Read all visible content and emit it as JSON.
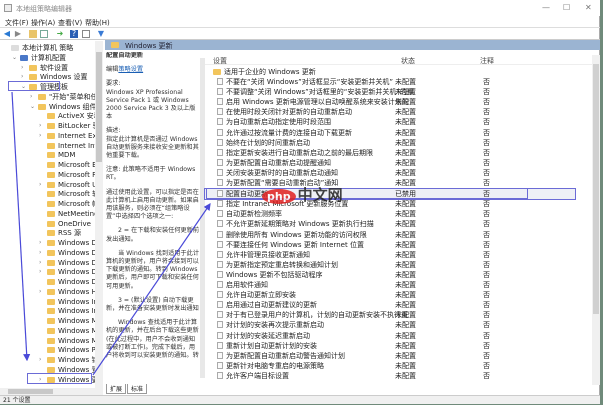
{
  "window": {
    "title": "本地组策略编辑器",
    "controls": [
      "—",
      "☐",
      "✕"
    ]
  },
  "menu": [
    "文件(F)",
    "操作(A)",
    "查看(V)",
    "帮助(H)"
  ],
  "tree": [
    {
      "label": "本地计算机 策略",
      "level": 0,
      "chev": ""
    },
    {
      "label": "计算机配置",
      "level": 1,
      "chev": "v"
    },
    {
      "label": "软件设置",
      "level": 2,
      "chev": ">"
    },
    {
      "label": "Windows 设置",
      "level": 2,
      "chev": ">"
    },
    {
      "label": "管理模板",
      "level": 2,
      "chev": "v"
    },
    {
      "label": "\"开始\"菜单和任务栏",
      "level": 3,
      "chev": ">"
    },
    {
      "label": "Windows 组件",
      "level": 3,
      "chev": "v"
    },
    {
      "label": "ActiveX 安装程序",
      "level": 4,
      "chev": ""
    },
    {
      "label": "BitLocker 驱动器",
      "level": 4,
      "chev": ">"
    },
    {
      "label": "Internet Explorer",
      "level": 4,
      "chev": ">"
    },
    {
      "label": "Internet Informa",
      "level": 4,
      "chev": ""
    },
    {
      "label": "MDM",
      "level": 4,
      "chev": ""
    },
    {
      "label": "Microsoft Edge",
      "level": 4,
      "chev": ""
    },
    {
      "label": "Microsoft FIDO",
      "level": 4,
      "chev": ""
    },
    {
      "label": "Microsoft User E",
      "level": 4,
      "chev": ">"
    },
    {
      "label": "Microsoft 辅助",
      "level": 4,
      "chev": ""
    },
    {
      "label": "Microsoft 帐户",
      "level": 4,
      "chev": ""
    },
    {
      "label": "NetMeeting",
      "level": 4,
      "chev": ""
    },
    {
      "label": "OneDrive",
      "level": 4,
      "chev": ""
    },
    {
      "label": "RSS 源",
      "level": 4,
      "chev": ""
    },
    {
      "label": "Windows Defen",
      "level": 4,
      "chev": ">"
    },
    {
      "label": "Windows Defen",
      "level": 4,
      "chev": ">"
    },
    {
      "label": "Windows Defen",
      "level": 4,
      "chev": ">"
    },
    {
      "label": "Windows Defen",
      "level": 4,
      "chev": ">"
    },
    {
      "label": "Windows Defen",
      "level": 4,
      "chev": ""
    },
    {
      "label": "Windows Hello 」",
      "level": 4,
      "chev": ">"
    },
    {
      "label": "Windows Ink 工",
      "level": 4,
      "chev": ""
    },
    {
      "label": "Windows Install",
      "level": 4,
      "chev": ""
    },
    {
      "label": "Windows Media",
      "level": 4,
      "chev": ""
    },
    {
      "label": "Windows Media",
      "level": 4,
      "chev": ""
    },
    {
      "label": "Windows Messe",
      "level": 4,
      "chev": ""
    },
    {
      "label": "Windows Power",
      "level": 4,
      "chev": ""
    },
    {
      "label": "Windows 错误报",
      "level": 4,
      "chev": ">"
    },
    {
      "label": "Windows 登录选",
      "level": 4,
      "chev": ""
    },
    {
      "label": "Windows 更新",
      "level": 4,
      "chev": ">"
    }
  ],
  "header": {
    "title": "Windows 更新"
  },
  "description": {
    "title": "配置自动更新",
    "edit_prefix": "编辑",
    "edit_link": "策略设置",
    "req_label": "要求:",
    "req_text": "Windows XP Professional Service Pack 1 或 Windows 2000 Service Pack 3 及以上版本",
    "desc_label": "描述:",
    "desc_text": "指定此计算机是否通过 Windows 自动更新服务来接收安全更新和其他重要下载。",
    "note": "注意: 此策略不适用于 Windows RT。",
    "p1": "通过使用此设置，可以指定是否在此计算机上启用自动更新。如果启用该服务，则必须在“组策略设置”中选择四个选项之一:",
    "p2": "2 = 在下载和安装任何更新前发出通知。",
    "p3": "当 Windows 找到适用于此计算机的更新时，用户将会接到可以下载更新的通知。转到 Windows 更新后，用户即可下载和安装任何可用更新。",
    "p4": "3 = (默认设置) 自动下载更新，并在准备安装更新时发出通知",
    "p5": "Windows 查找适用于此计算机的更新，并在后台下载这些更新(在此过程中，用户不会收到通知或被打断工作)。完成下载后，用户将收到可以安装更新的通知。转"
  },
  "tabs": [
    "扩展",
    "标准"
  ],
  "columns": {
    "setting": "设置",
    "state": "状态",
    "comment": "注释"
  },
  "folder_row": "适用于企业的 Windows 更新",
  "rows": [
    [
      "不要在“关闭 Windows”对话框显示“安装更新并关机”",
      "未配置",
      "否"
    ],
    [
      "不要调整“关闭 Windows”对话框里的“安装更新并关机”的默",
      "未配置",
      "否"
    ],
    [
      "启用 Windows 更新电源管理以自动唤醒系统来安装计划的",
      "未配置",
      "否"
    ],
    [
      "在使用时段关闭针对更新的自动重新启动",
      "未配置",
      "否"
    ],
    [
      "为自动重新启动指定使用时段范围",
      "未配置",
      "否"
    ],
    [
      "允许通过按流量计费的连接自动下载更新",
      "未配置",
      "否"
    ],
    [
      "始终在计划的时间重新启动",
      "未配置",
      "否"
    ],
    [
      "指定更新安装进行自动重新启动之前的最后期限",
      "未配置",
      "否"
    ],
    [
      "为更新配置自动重新启动提醒通知",
      "未配置",
      "否"
    ],
    [
      "关闭安装更新时的自动重新启动通知",
      "未配置",
      "否"
    ],
    [
      "为更新配置“需要自动重新启动”通知",
      "未配置",
      "否"
    ],
    [
      "配置自动更新",
      "已禁用",
      "否"
    ],
    [
      "指定 Intranet Microsoft 更新服务位置",
      "未配置",
      "否"
    ],
    [
      "自动更新检测频率",
      "未配置",
      "否"
    ],
    [
      "不允许更新延期策略对 Windows 更新执行扫描",
      "未配置",
      "否"
    ],
    [
      "删除使用所有 Windows 更新功能的访问权限",
      "未配置",
      "否"
    ],
    [
      "不要连接任何 Windows 更新 Internet 位置",
      "未配置",
      "否"
    ],
    [
      "允许非管理员接收更新通知",
      "未配置",
      "否"
    ],
    [
      "为更新指定预定重启转换和通知计划",
      "未配置",
      "否"
    ],
    [
      "Windows 更新不包括驱动程序",
      "未配置",
      "否"
    ],
    [
      "启用软件通知",
      "未配置",
      "否"
    ],
    [
      "允许自动更新立即安装",
      "未配置",
      "否"
    ],
    [
      "启用通过自动更新建议的更新",
      "未配置",
      "否"
    ],
    [
      "对于有已登录用户的计算机，计划的自动更新安装不执行重",
      "未配置",
      "否"
    ],
    [
      "对计划的安装再次提示重新启动",
      "未配置",
      "否"
    ],
    [
      "对计划的安装延迟重新启动",
      "未配置",
      "否"
    ],
    [
      "重新计划自动更新计划的安装",
      "未配置",
      "否"
    ],
    [
      "为更新配置自动重新启动警告通知计划",
      "未配置",
      "否"
    ],
    [
      "更新针对电脑专重启的电源策略",
      "未配置",
      "否"
    ],
    [
      "允许客户端目标设置",
      "未配置",
      "否"
    ]
  ],
  "selected_index": 11,
  "status": "21 个设置",
  "watermark": {
    "logo": "php",
    "text": "中文网"
  }
}
